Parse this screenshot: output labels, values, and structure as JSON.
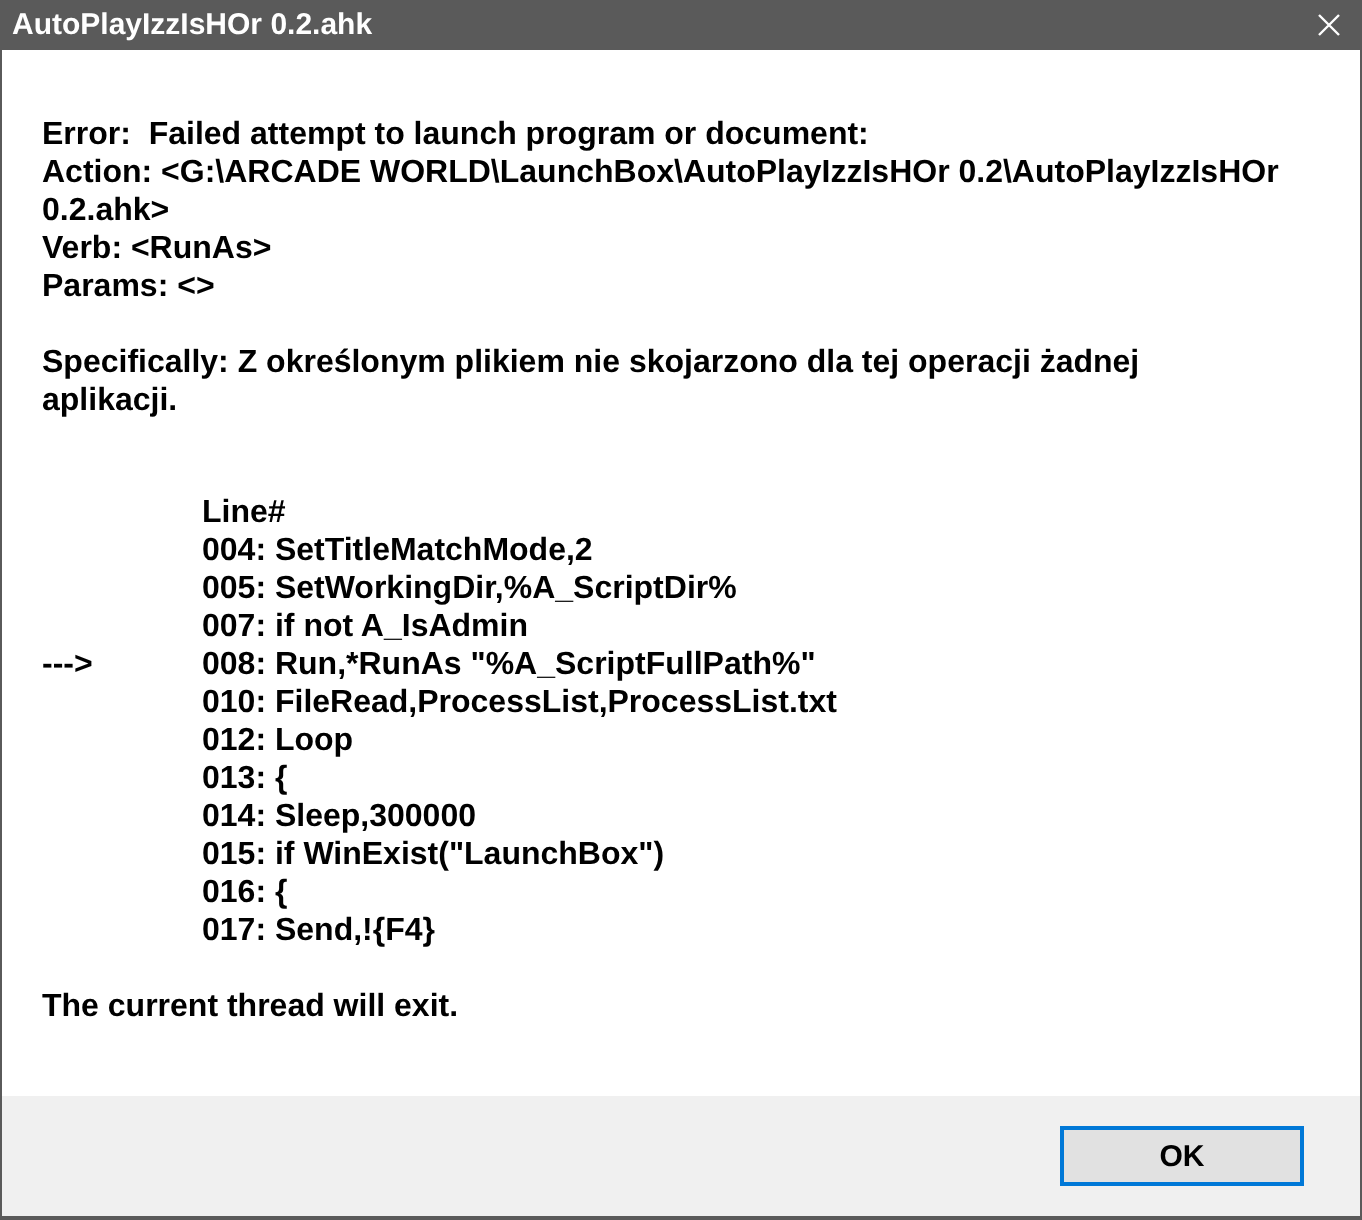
{
  "window": {
    "title": "AutoPlayIzzIsHOr 0.2.ahk"
  },
  "message": {
    "error": "Error:  Failed attempt to launch program or document:",
    "action": "Action: <G:\\ARCADE WORLD\\LaunchBox\\AutoPlayIzzIsHOr 0.2\\AutoPlayIzzIsHOr 0.2.ahk>",
    "verb": "Verb: <RunAs>",
    "params": "Params: <>",
    "specifically": "Specifically: Z określonym plikiem nie skojarzono dla tej operacji żadnej aplikacji."
  },
  "listing": {
    "header": "Line#",
    "lines": [
      {
        "text": "004: SetTitleMatchMode,2"
      },
      {
        "text": "005: SetWorkingDir,%A_ScriptDir%"
      },
      {
        "text": "007: if not A_IsAdmin"
      },
      {
        "marker": "--->",
        "text": "008: Run,*RunAs \"%A_ScriptFullPath%\""
      },
      {
        "text": "010: FileRead,ProcessList,ProcessList.txt"
      },
      {
        "text": "012: Loop"
      },
      {
        "text": "013: {"
      },
      {
        "text": "014: Sleep,300000"
      },
      {
        "text": "015: if WinExist(\"LaunchBox\")"
      },
      {
        "text": "016: {"
      },
      {
        "text": "017: Send,!{F4}"
      }
    ]
  },
  "notice": "The current thread will exit.",
  "buttons": [
    {
      "label": "OK",
      "focused": true
    }
  ]
}
